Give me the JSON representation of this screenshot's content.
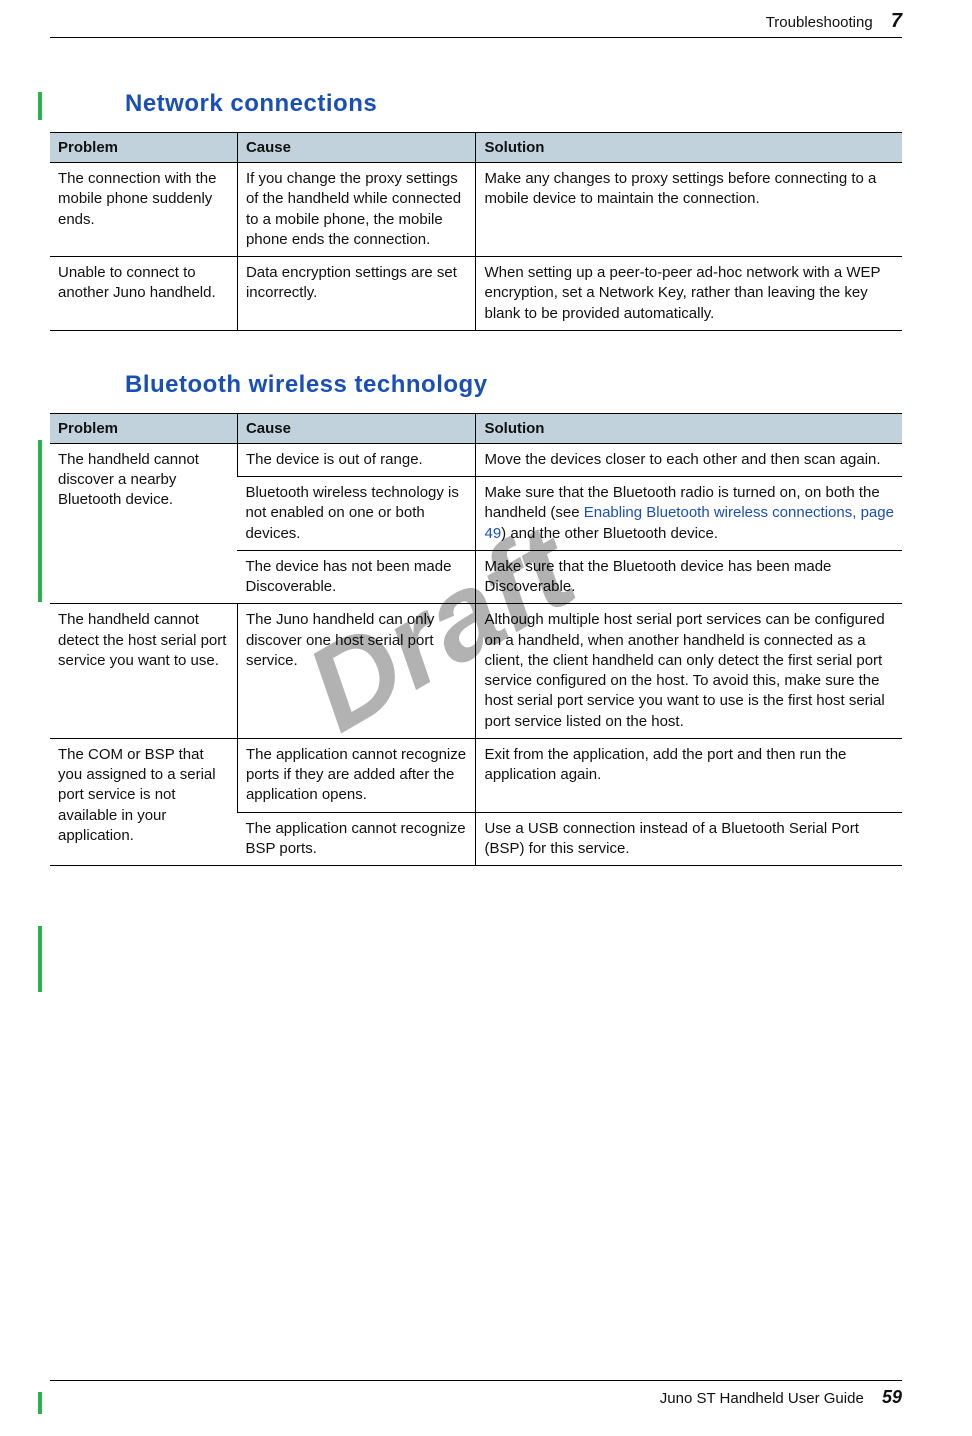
{
  "header": {
    "section": "Troubleshooting",
    "chapter": "7"
  },
  "watermark": "Draft",
  "footer": {
    "guide": "Juno ST Handheld User Guide",
    "page": "59"
  },
  "sections": [
    {
      "title": "Network connections",
      "head": {
        "c1": "Problem",
        "c2": "Cause",
        "c3": "Solution"
      },
      "rows": [
        {
          "problem": "The connection with the mobile phone suddenly ends.",
          "cause": "If you change the proxy settings of the handheld while connected to a mobile phone, the mobile phone ends the connection.",
          "solution": "Make any changes to proxy settings before connecting to a mobile device to maintain the connection."
        },
        {
          "problem": "Unable to connect to another Juno handheld.",
          "cause": "Data encryption settings are set incorrectly.",
          "solution": "When setting up a peer-to-peer ad-hoc network with a WEP encryption, set a Network Key, rather than leaving the key blank to be provided automatically."
        }
      ]
    },
    {
      "title": "Bluetooth wireless technology",
      "head": {
        "c1": "Problem",
        "c2": "Cause",
        "c3": "Solution"
      },
      "rows": [
        {
          "problem": "The handheld cannot discover a nearby Bluetooth device.",
          "rowspan": 3,
          "cause": "The device is out of range.",
          "solution": "Move the devices closer to each other and then scan again."
        },
        {
          "cause": "Bluetooth wireless technology is not enabled on one or both devices.",
          "solution_pre": "Make sure that the Bluetooth radio is turned on, on both the handheld (see ",
          "solution_link": "Enabling Bluetooth wireless connections, page 49",
          "solution_post": ") and the other Bluetooth device."
        },
        {
          "cause": "The device has not been made Discoverable.",
          "solution": "Make sure that the Bluetooth device has been made Discoverable."
        },
        {
          "problem": "The handheld cannot detect the host serial port service you want to use.",
          "cause": "The Juno handheld can only discover one host serial port service.",
          "solution": "Although multiple host serial port services can be configured on a handheld, when another handheld is connected as a client, the client handheld can only detect the first serial port service configured on the host. To avoid this, make sure the host serial port service you want to use is the first host serial port service listed on the host."
        },
        {
          "problem": "The COM or BSP that you assigned to a serial port service is not available in your application.",
          "rowspan": 2,
          "cause": "The application cannot recognize ports if they are added after the application opens.",
          "solution": "Exit from the application, add the port and then run the application again."
        },
        {
          "cause": "The application cannot recognize BSP ports.",
          "solution": "Use a USB connection instead of a Bluetooth Serial Port (BSP) for this service."
        }
      ]
    }
  ]
}
